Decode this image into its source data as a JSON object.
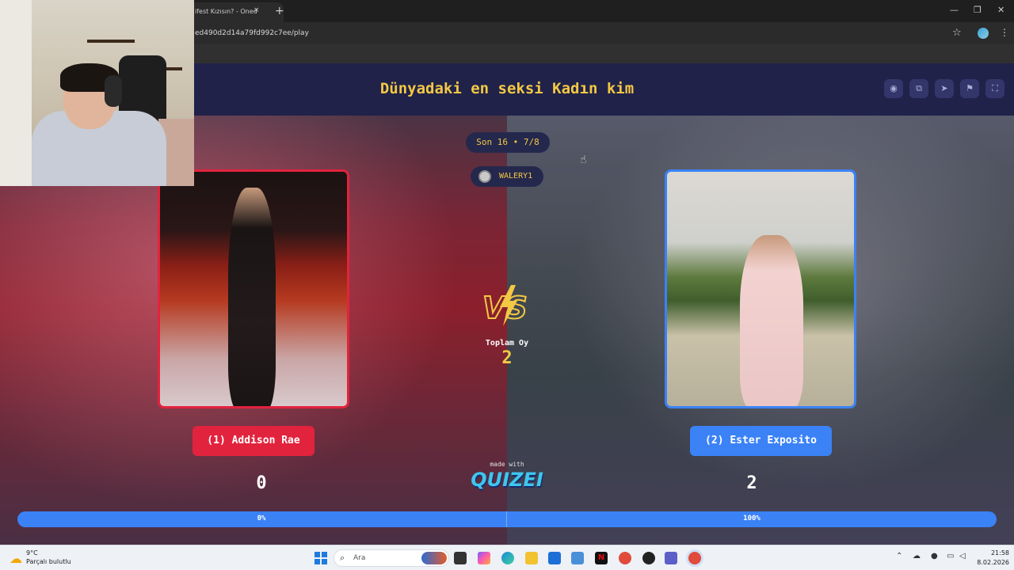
{
  "browser": {
    "tab_title": "ifest Kızısın? - Oned",
    "tab_close": "×",
    "new_tab": "+",
    "url": "ed490d2d14a79fd992c7ee/play",
    "star": "☆",
    "menu": "⋮",
    "window_controls": {
      "minimize": "—",
      "restore": "❐",
      "close": "✕"
    }
  },
  "quiz": {
    "title": "Dünyadaki en seksi Kadın kim",
    "header_buttons": [
      {
        "icon": "eye-icon",
        "glyph": "◉"
      },
      {
        "icon": "share-icon",
        "glyph": "⧉"
      },
      {
        "icon": "send-icon",
        "glyph": "➤"
      },
      {
        "icon": "flag-icon",
        "glyph": "⚑"
      },
      {
        "icon": "fullscreen-icon",
        "glyph": "⛶"
      }
    ],
    "round": "Son 16 • 7/8",
    "user": "WALERY1",
    "total_votes_label": "Toplam Oy",
    "total_votes": "2",
    "left": {
      "label": "(1) Addison Rae",
      "score": "0",
      "percent_label": "0%",
      "percent": 0,
      "color": "#e2233d"
    },
    "right": {
      "label": "(2) Ester Exposito",
      "score": "2",
      "percent_label": "100%",
      "percent": 100,
      "color": "#3b82f6"
    },
    "made_with": "made with",
    "brand": "QUIZEI",
    "accent": "#f3c844"
  },
  "taskbar": {
    "temperature": "9°C",
    "weather": "Parçalı bulutlu",
    "search_placeholder": "Ara",
    "time": "21:58",
    "date": "8.02.2026"
  }
}
